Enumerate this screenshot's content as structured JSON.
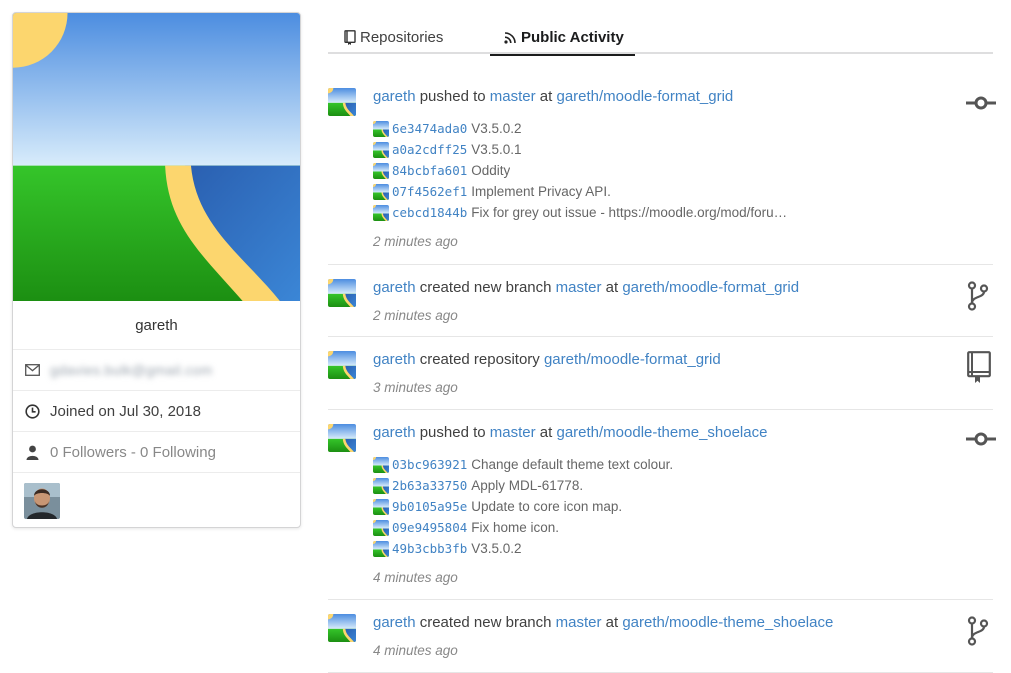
{
  "profile": {
    "name": "gareth",
    "email": "gdavies.bulk@gmail.com",
    "joined": "Joined on Jul 30, 2018",
    "followers": "0 Followers",
    "separator": " - ",
    "following": "0 Following",
    "image_icon": "generic-landscape-image",
    "organization_avatar": "user-photo-avatar"
  },
  "tabs": [
    {
      "label": "Repositories",
      "icon": "repo-book-icon",
      "active": false
    },
    {
      "label": "Public Activity",
      "icon": "rss-feed-icon",
      "active": true
    }
  ],
  "feed": [
    {
      "user": "gareth",
      "action": "pushed to",
      "target": "master",
      "preposition": "at",
      "repo": "gareth/moodle-format_grid",
      "op_icon": "commit-icon",
      "commits": [
        {
          "sha": "6e3474ada0",
          "message": "V3.5.0.2"
        },
        {
          "sha": "a0a2cdff25",
          "message": "V3.5.0.1"
        },
        {
          "sha": "84bcbfa601",
          "message": "Oddity"
        },
        {
          "sha": "07f4562ef1",
          "message": "Implement Privacy API."
        },
        {
          "sha": "cebcd1844b",
          "message": "Fix for grey out issue - https://moodle.org/mod/foru…"
        }
      ],
      "time": "2 minutes ago"
    },
    {
      "user": "gareth",
      "action": "created new branch",
      "target": "master",
      "preposition": "at",
      "repo": "gareth/moodle-format_grid",
      "op_icon": "git-branch-icon",
      "commits": [],
      "time": "2 minutes ago"
    },
    {
      "user": "gareth",
      "action": "created repository",
      "target": "",
      "preposition": "",
      "repo": "gareth/moodle-format_grid",
      "op_icon": "repo-icon",
      "commits": [],
      "time": "3 minutes ago"
    },
    {
      "user": "gareth",
      "action": "pushed to",
      "target": "master",
      "preposition": "at",
      "repo": "gareth/moodle-theme_shoelace",
      "op_icon": "commit-icon",
      "commits": [
        {
          "sha": "03bc963921",
          "message": "Change default theme text colour."
        },
        {
          "sha": "2b63a33750",
          "message": "Apply MDL-61778."
        },
        {
          "sha": "9b0105a95e",
          "message": "Update to core icon map."
        },
        {
          "sha": "09e9495804",
          "message": "Fix home icon."
        },
        {
          "sha": "49b3cbb3fb",
          "message": "V3.5.0.2"
        }
      ],
      "time": "4 minutes ago"
    },
    {
      "user": "gareth",
      "action": "created new branch",
      "target": "master",
      "preposition": "at",
      "repo": "gareth/moodle-theme_shoelace",
      "op_icon": "git-branch-icon",
      "commits": [],
      "time": "4 minutes ago"
    }
  ],
  "colors": {
    "link": "#4183c4",
    "sky_top": "#4c8de0",
    "sky_bottom": "#d8ecfb",
    "grass": "#2dbb22",
    "water": "#2d6bc0",
    "sand": "#fcd66e"
  }
}
